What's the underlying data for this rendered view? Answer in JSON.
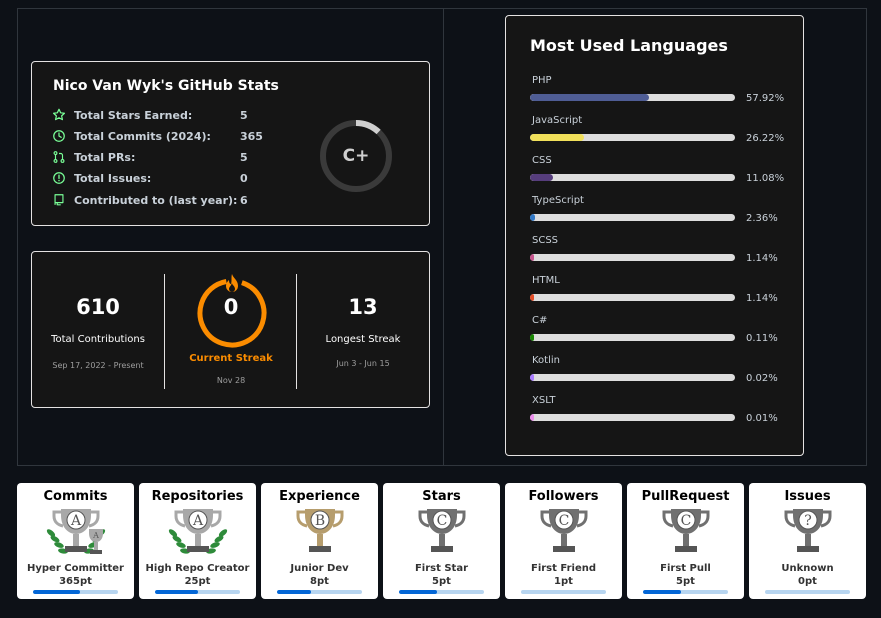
{
  "stats": {
    "title": "Nico Van Wyk's GitHub Stats",
    "rows": [
      {
        "label": "Total Stars Earned:",
        "value": "5",
        "icon": "star-icon"
      },
      {
        "label": "Total Commits (2024):",
        "value": "365",
        "icon": "history-icon"
      },
      {
        "label": "Total PRs:",
        "value": "5",
        "icon": "pull-request-icon"
      },
      {
        "label": "Total Issues:",
        "value": "0",
        "icon": "issue-icon"
      },
      {
        "label": "Contributed to (last year):",
        "value": "6",
        "icon": "repo-icon"
      }
    ],
    "grade": "C+",
    "grade_progress": 0.12,
    "accent": "#79ff97",
    "ring_color": "#cfcfcf"
  },
  "streak": {
    "total": {
      "value": "610",
      "label": "Total Contributions",
      "range": "Sep 17, 2022 - Present"
    },
    "current": {
      "value": "0",
      "label": "Current Streak",
      "range": "Nov 28"
    },
    "longest": {
      "value": "13",
      "label": "Longest Streak",
      "range": "Jun 3 - Jun 15"
    },
    "ring_color": "#fb8c00"
  },
  "languages": {
    "title": "Most Used Languages",
    "items": [
      {
        "name": "PHP",
        "percent": "57.92%",
        "fraction": 0.5792,
        "color": "#4F5D95"
      },
      {
        "name": "JavaScript",
        "percent": "26.22%",
        "fraction": 0.2622,
        "color": "#f1e05a"
      },
      {
        "name": "CSS",
        "percent": "11.08%",
        "fraction": 0.1108,
        "color": "#563d7c"
      },
      {
        "name": "TypeScript",
        "percent": "2.36%",
        "fraction": 0.0236,
        "color": "#3178c6"
      },
      {
        "name": "SCSS",
        "percent": "1.14%",
        "fraction": 0.0114,
        "color": "#c6538c"
      },
      {
        "name": "HTML",
        "percent": "1.14%",
        "fraction": 0.0114,
        "color": "#e34c26"
      },
      {
        "name": "C#",
        "percent": "0.11%",
        "fraction": 0.0011,
        "color": "#178600"
      },
      {
        "name": "Kotlin",
        "percent": "0.02%",
        "fraction": 0.0002,
        "color": "#A97BFF"
      },
      {
        "name": "XSLT",
        "percent": "0.01%",
        "fraction": 0.0001,
        "color": "#EB8CEB"
      }
    ]
  },
  "trophies": [
    {
      "title": "Commits",
      "rank": "A",
      "name": "Hyper Committer",
      "points": "365pt",
      "progress": 0.55,
      "laurel": true,
      "color": "#a8a8a8",
      "extra_cup": "A"
    },
    {
      "title": "Repositories",
      "rank": "A",
      "name": "High Repo Creator",
      "points": "25pt",
      "progress": 0.5,
      "laurel": true,
      "color": "#a8a8a8",
      "extra_cup": ""
    },
    {
      "title": "Experience",
      "rank": "B",
      "name": "Junior Dev",
      "points": "8pt",
      "progress": 0.4,
      "laurel": false,
      "color": "#b69d6d",
      "extra_cup": ""
    },
    {
      "title": "Stars",
      "rank": "C",
      "name": "First Star",
      "points": "5pt",
      "progress": 0.45,
      "laurel": false,
      "color": "#707070",
      "extra_cup": ""
    },
    {
      "title": "Followers",
      "rank": "C",
      "name": "First Friend",
      "points": "1pt",
      "progress": 0.0,
      "laurel": false,
      "color": "#707070",
      "extra_cup": ""
    },
    {
      "title": "PullRequest",
      "rank": "C",
      "name": "First Pull",
      "points": "5pt",
      "progress": 0.45,
      "laurel": false,
      "color": "#707070",
      "extra_cup": ""
    },
    {
      "title": "Issues",
      "rank": "?",
      "name": "Unknown",
      "points": "0pt",
      "progress": 0.0,
      "laurel": false,
      "color": "#707070",
      "extra_cup": ""
    }
  ]
}
